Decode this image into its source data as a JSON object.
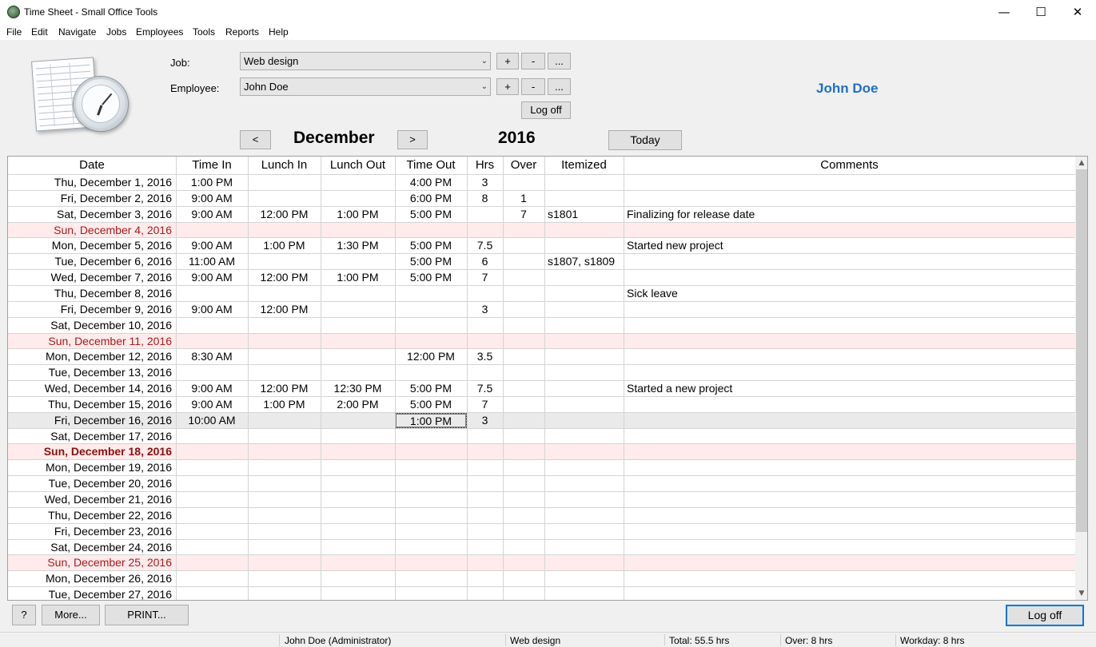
{
  "window": {
    "title": "Time Sheet - Small Office Tools",
    "min_glyph": "—",
    "max_glyph": "☐",
    "close_glyph": "✕"
  },
  "menu": [
    "File",
    "Edit",
    "Navigate",
    "Jobs",
    "Employees",
    "Tools",
    "Reports",
    "Help"
  ],
  "form": {
    "job_label": "Job:",
    "job_value": "Web design",
    "employee_label": "Employee:",
    "employee_value": "John Doe",
    "add_label": "+",
    "remove_label": "-",
    "more_label": "...",
    "logoff_label": "Log off",
    "dropdown_glyph": "⌄"
  },
  "user_display_name": "John Doe",
  "calendar": {
    "prev_label": "<",
    "next_label": ">",
    "month": "December",
    "year": "2016",
    "today_label": "Today"
  },
  "grid": {
    "columns": [
      "Date",
      "Time In",
      "Lunch In",
      "Lunch Out",
      "Time Out",
      "Hrs",
      "Over",
      "Itemized",
      "Comments"
    ],
    "rows": [
      {
        "date": "Thu, December 1, 2016",
        "in": "1:00 PM",
        "lunch_in": "",
        "lunch_out": "",
        "out": "4:00 PM",
        "hrs": "3",
        "over": "",
        "itemized": "",
        "comments": ""
      },
      {
        "date": "Fri, December 2, 2016",
        "in": "9:00 AM",
        "lunch_in": "",
        "lunch_out": "",
        "out": "6:00 PM",
        "hrs": "8",
        "over": "1",
        "itemized": "",
        "comments": ""
      },
      {
        "date": "Sat, December 3, 2016",
        "in": "9:00 AM",
        "lunch_in": "12:00 PM",
        "lunch_out": "1:00 PM",
        "out": "5:00 PM",
        "hrs": "",
        "over": "7",
        "itemized": "s1801",
        "comments": "Finalizing for release date"
      },
      {
        "date": "Sun, December 4, 2016",
        "in": "",
        "lunch_in": "",
        "lunch_out": "",
        "out": "",
        "hrs": "",
        "over": "",
        "itemized": "",
        "comments": "",
        "weekend": true
      },
      {
        "date": "Mon, December 5, 2016",
        "in": "9:00 AM",
        "lunch_in": "1:00 PM",
        "lunch_out": "1:30 PM",
        "out": "5:00 PM",
        "hrs": "7.5",
        "over": "",
        "itemized": "",
        "comments": "Started new project"
      },
      {
        "date": "Tue, December 6, 2016",
        "in": "11:00 AM",
        "lunch_in": "",
        "lunch_out": "",
        "out": "5:00 PM",
        "hrs": "6",
        "over": "",
        "itemized": "s1807, s1809",
        "comments": ""
      },
      {
        "date": "Wed, December 7, 2016",
        "in": "9:00 AM",
        "lunch_in": "12:00 PM",
        "lunch_out": "1:00 PM",
        "out": "5:00 PM",
        "hrs": "7",
        "over": "",
        "itemized": "",
        "comments": ""
      },
      {
        "date": "Thu, December 8, 2016",
        "in": "",
        "lunch_in": "",
        "lunch_out": "",
        "out": "",
        "hrs": "",
        "over": "",
        "itemized": "",
        "comments": "Sick leave"
      },
      {
        "date": "Fri, December 9, 2016",
        "in": "9:00 AM",
        "lunch_in": "12:00 PM",
        "lunch_out": "",
        "out": "",
        "hrs": "3",
        "over": "",
        "itemized": "",
        "comments": ""
      },
      {
        "date": "Sat, December 10, 2016",
        "in": "",
        "lunch_in": "",
        "lunch_out": "",
        "out": "",
        "hrs": "",
        "over": "",
        "itemized": "",
        "comments": ""
      },
      {
        "date": "Sun, December 11, 2016",
        "in": "",
        "lunch_in": "",
        "lunch_out": "",
        "out": "",
        "hrs": "",
        "over": "",
        "itemized": "",
        "comments": "",
        "weekend": true
      },
      {
        "date": "Mon, December 12, 2016",
        "in": "8:30 AM",
        "lunch_in": "",
        "lunch_out": "",
        "out": "12:00 PM",
        "hrs": "3.5",
        "over": "",
        "itemized": "",
        "comments": ""
      },
      {
        "date": "Tue, December 13, 2016",
        "in": "",
        "lunch_in": "",
        "lunch_out": "",
        "out": "",
        "hrs": "",
        "over": "",
        "itemized": "",
        "comments": ""
      },
      {
        "date": "Wed, December 14, 2016",
        "in": "9:00 AM",
        "lunch_in": "12:00 PM",
        "lunch_out": "12:30 PM",
        "out": "5:00 PM",
        "hrs": "7.5",
        "over": "",
        "itemized": "",
        "comments": "Started a new project"
      },
      {
        "date": "Thu, December 15, 2016",
        "in": "9:00 AM",
        "lunch_in": "1:00 PM",
        "lunch_out": "2:00 PM",
        "out": "5:00 PM",
        "hrs": "7",
        "over": "",
        "itemized": "",
        "comments": ""
      },
      {
        "date": "Fri, December 16, 2016",
        "in": "10:00 AM",
        "lunch_in": "",
        "lunch_out": "",
        "out": "1:00 PM",
        "hrs": "3",
        "over": "",
        "itemized": "",
        "comments": "",
        "selected": true
      },
      {
        "date": "Sat, December 17, 2016",
        "in": "",
        "lunch_in": "",
        "lunch_out": "",
        "out": "",
        "hrs": "",
        "over": "",
        "itemized": "",
        "comments": ""
      },
      {
        "date": "Sun, December 18, 2016",
        "in": "",
        "lunch_in": "",
        "lunch_out": "",
        "out": "",
        "hrs": "",
        "over": "",
        "itemized": "",
        "comments": "",
        "weekend": true,
        "today": true
      },
      {
        "date": "Mon, December 19, 2016",
        "in": "",
        "lunch_in": "",
        "lunch_out": "",
        "out": "",
        "hrs": "",
        "over": "",
        "itemized": "",
        "comments": ""
      },
      {
        "date": "Tue, December 20, 2016",
        "in": "",
        "lunch_in": "",
        "lunch_out": "",
        "out": "",
        "hrs": "",
        "over": "",
        "itemized": "",
        "comments": ""
      },
      {
        "date": "Wed, December 21, 2016",
        "in": "",
        "lunch_in": "",
        "lunch_out": "",
        "out": "",
        "hrs": "",
        "over": "",
        "itemized": "",
        "comments": ""
      },
      {
        "date": "Thu, December 22, 2016",
        "in": "",
        "lunch_in": "",
        "lunch_out": "",
        "out": "",
        "hrs": "",
        "over": "",
        "itemized": "",
        "comments": ""
      },
      {
        "date": "Fri, December 23, 2016",
        "in": "",
        "lunch_in": "",
        "lunch_out": "",
        "out": "",
        "hrs": "",
        "over": "",
        "itemized": "",
        "comments": ""
      },
      {
        "date": "Sat, December 24, 2016",
        "in": "",
        "lunch_in": "",
        "lunch_out": "",
        "out": "",
        "hrs": "",
        "over": "",
        "itemized": "",
        "comments": ""
      },
      {
        "date": "Sun, December 25, 2016",
        "in": "",
        "lunch_in": "",
        "lunch_out": "",
        "out": "",
        "hrs": "",
        "over": "",
        "itemized": "",
        "comments": "",
        "weekend": true
      },
      {
        "date": "Mon, December 26, 2016",
        "in": "",
        "lunch_in": "",
        "lunch_out": "",
        "out": "",
        "hrs": "",
        "over": "",
        "itemized": "",
        "comments": ""
      },
      {
        "date": "Tue, December 27, 2016",
        "in": "",
        "lunch_in": "",
        "lunch_out": "",
        "out": "",
        "hrs": "",
        "over": "",
        "itemized": "",
        "comments": ""
      }
    ]
  },
  "bottom": {
    "help_label": "?",
    "more_label": "More...",
    "print_label": "PRINT...",
    "logoff_label": "Log off"
  },
  "status": {
    "user": "John Doe (Administrator)",
    "job": "Web design",
    "total": "Total: 55.5 hrs",
    "over": "Over: 8 hrs",
    "workday": "Workday: 8 hrs"
  },
  "colors": {
    "accent": "#1f6fc7",
    "weekend_row": "#ffebeb",
    "weekend_text": "#a61b1b",
    "today_text": "#8a0f0f"
  },
  "icons": {
    "scroll_up": "▲",
    "scroll_down": "▼"
  }
}
